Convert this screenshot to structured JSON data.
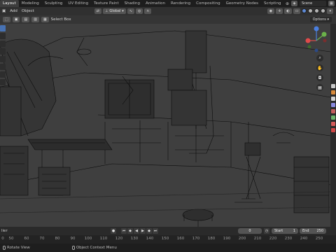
{
  "app": {
    "workspace_tabs": [
      "Layout",
      "Modeling",
      "Sculpting",
      "UV Editing",
      "Texture Paint",
      "Shading",
      "Animation",
      "Rendering",
      "Compositing",
      "Geometry Nodes",
      "Scripting"
    ],
    "active_tab": "Layout",
    "more_tabs_icon": "plus-icon",
    "scene_name": "Scene"
  },
  "header": {
    "menus": [
      "Add",
      "Object"
    ],
    "orientation_label": "Global",
    "options_label": "Options"
  },
  "toolbar": {
    "select_mode_label": "Select Box"
  },
  "timeline": {
    "left_label": "lier",
    "current_frame": "0",
    "start_label": "Start",
    "start_value": "1",
    "end_label": "End",
    "end_value": "250"
  },
  "ruler": {
    "ticks": [
      "0",
      "50",
      "60",
      "70",
      "80",
      "90",
      "100",
      "110",
      "120",
      "130",
      "140",
      "150",
      "160",
      "170",
      "180",
      "190",
      "200",
      "210",
      "220",
      "230",
      "240",
      "250"
    ]
  },
  "statusbar": {
    "rotate_view": "Rotate View",
    "context_menu": "Object Context Menu"
  },
  "colors": {
    "active_blue": "#4772b3",
    "gizmo_x": "#e04a4a",
    "gizmo_y": "#6bb34a",
    "gizmo_z": "#4a7fe0"
  }
}
